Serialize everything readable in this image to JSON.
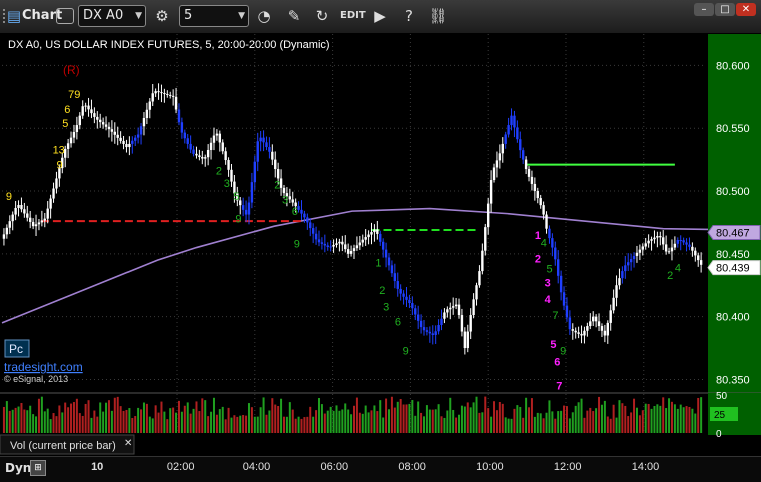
{
  "window": {
    "app_title": "Chart",
    "symbol": "DX A0",
    "interval": "5",
    "minimize_icon": "minimize-icon",
    "maximize_icon": "maximize-icon",
    "close_icon": "close-icon"
  },
  "chart_header": {
    "title": "DX A0, US DOLLAR INDEX FUTURES, 5, 20:00-20:00 (Dynamic)",
    "badge_r": "(R)"
  },
  "branding": {
    "pc_label": "Pc",
    "site": "tradesight.com",
    "copyright": "© eSignal, 2013"
  },
  "colors": {
    "background": "#000000",
    "price_axis_bg": "#006000",
    "grid": "#3a3a3a",
    "bar": "#ffffff",
    "bar_down_run": "#1f3fff",
    "moving_average": "#a080d0",
    "resistance_line": "#e02020",
    "support_line": "#20e020",
    "top_line": "#40ff40",
    "count_yellow": "#ffe020",
    "count_green": "#20b020",
    "count_magenta": "#ff20ff"
  },
  "chart_data": {
    "type": "candlestick",
    "ylim": [
      80.34,
      80.625
    ],
    "ytick_labels": [
      "80.600",
      "80.550",
      "80.500",
      "80.450",
      "80.400",
      "80.350"
    ],
    "xtick_labels": [
      "10",
      "02:00",
      "04:00",
      "06:00",
      "08:00",
      "10:00",
      "12:00",
      "14:00"
    ],
    "price_markers": [
      {
        "label": "80.467",
        "value": 80.467,
        "style": "purple"
      },
      {
        "label": "80.439",
        "value": 80.439,
        "style": "white"
      }
    ],
    "moving_average_points": [
      [
        0,
        80.395
      ],
      [
        2,
        80.42
      ],
      [
        4,
        80.445
      ],
      [
        5,
        80.455
      ],
      [
        7,
        80.472
      ],
      [
        9,
        80.484
      ],
      [
        11,
        80.486
      ],
      [
        13,
        80.482
      ],
      [
        15,
        80.476
      ],
      [
        17,
        80.47
      ],
      [
        19,
        80.469
      ],
      [
        21,
        80.472
      ],
      [
        23,
        80.472
      ],
      [
        25,
        80.47
      ],
      [
        27,
        80.468
      ],
      [
        28,
        80.467
      ]
    ],
    "horizontal_lines": [
      {
        "name": "red-dashed",
        "value": 80.476,
        "x_start": 1.0,
        "x_end": 7.75,
        "style": "dashed",
        "color": "red"
      },
      {
        "name": "green-dashed",
        "value": 80.469,
        "x_start": 9.5,
        "x_end": 12.2,
        "style": "dashed",
        "color": "green"
      },
      {
        "name": "green-solid",
        "value": 80.521,
        "x_start": 13.5,
        "x_end": 17.3,
        "style": "solid",
        "color": "brightgreen"
      }
    ],
    "price_path": [
      [
        0.0,
        80.462
      ],
      [
        0.4,
        80.49
      ],
      [
        0.8,
        80.472
      ],
      [
        1.1,
        80.478
      ],
      [
        1.4,
        80.51
      ],
      [
        1.6,
        80.532
      ],
      [
        1.9,
        80.55
      ],
      [
        2.1,
        80.57
      ],
      [
        2.4,
        80.558
      ],
      [
        2.8,
        80.548
      ],
      [
        3.2,
        80.535
      ],
      [
        3.5,
        80.545
      ],
      [
        3.9,
        80.58
      ],
      [
        4.1,
        80.578
      ],
      [
        4.4,
        80.575
      ],
      [
        4.6,
        80.548
      ],
      [
        4.9,
        80.53
      ],
      [
        5.2,
        80.525
      ],
      [
        5.5,
        80.548
      ],
      [
        5.8,
        80.52
      ],
      [
        6.0,
        80.495
      ],
      [
        6.3,
        80.48
      ],
      [
        6.6,
        80.545
      ],
      [
        6.9,
        80.53
      ],
      [
        7.2,
        80.5
      ],
      [
        7.5,
        80.49
      ],
      [
        7.8,
        80.478
      ],
      [
        8.1,
        80.46
      ],
      [
        8.4,
        80.455
      ],
      [
        8.7,
        80.46
      ],
      [
        8.9,
        80.45
      ],
      [
        9.3,
        80.462
      ],
      [
        9.6,
        80.47
      ],
      [
        9.9,
        80.445
      ],
      [
        10.2,
        80.42
      ],
      [
        10.5,
        80.41
      ],
      [
        10.8,
        80.39
      ],
      [
        11.1,
        80.385
      ],
      [
        11.4,
        80.405
      ],
      [
        11.7,
        80.41
      ],
      [
        11.9,
        80.375
      ],
      [
        12.1,
        80.41
      ],
      [
        12.3,
        80.44
      ],
      [
        12.6,
        80.515
      ],
      [
        12.8,
        80.53
      ],
      [
        13.1,
        80.56
      ],
      [
        13.3,
        80.535
      ],
      [
        13.5,
        80.515
      ],
      [
        13.7,
        80.5
      ],
      [
        13.9,
        80.485
      ],
      [
        14.0,
        80.47
      ],
      [
        14.2,
        80.45
      ],
      [
        14.4,
        80.415
      ],
      [
        14.6,
        80.39
      ],
      [
        14.9,
        80.385
      ],
      [
        15.2,
        80.4
      ],
      [
        15.5,
        80.385
      ],
      [
        15.8,
        80.425
      ],
      [
        16.0,
        80.44
      ],
      [
        16.3,
        80.45
      ],
      [
        16.6,
        80.46
      ],
      [
        16.9,
        80.465
      ],
      [
        17.1,
        80.45
      ],
      [
        17.4,
        80.462
      ],
      [
        17.7,
        80.455
      ],
      [
        18.0,
        80.44
      ]
    ],
    "down_runs": [
      [
        3.3,
        3.6
      ],
      [
        4.5,
        5.0
      ],
      [
        6.2,
        6.9
      ],
      [
        7.6,
        8.5
      ],
      [
        9.7,
        11.3
      ],
      [
        12.9,
        13.4
      ],
      [
        14.0,
        14.6
      ],
      [
        15.9,
        16.3
      ],
      [
        17.3,
        17.7
      ]
    ],
    "count_labels": [
      {
        "text": "9",
        "x": 0.1,
        "y": 80.493,
        "color": "yellow"
      },
      {
        "text": "79",
        "x": 1.7,
        "y": 80.574,
        "color": "yellow"
      },
      {
        "text": "6",
        "x": 1.6,
        "y": 80.562,
        "color": "yellow"
      },
      {
        "text": "5",
        "x": 1.55,
        "y": 80.551,
        "color": "yellow"
      },
      {
        "text": "13",
        "x": 1.3,
        "y": 80.53,
        "color": "yellow"
      },
      {
        "text": "9",
        "x": 1.4,
        "y": 80.518,
        "color": "yellow"
      },
      {
        "text": "2",
        "x": 5.5,
        "y": 80.513,
        "color": "green"
      },
      {
        "text": "3",
        "x": 5.7,
        "y": 80.503,
        "color": "green"
      },
      {
        "text": "5",
        "x": 5.95,
        "y": 80.493,
        "color": "green"
      },
      {
        "text": "9",
        "x": 6.0,
        "y": 80.475,
        "color": "green"
      },
      {
        "text": "2",
        "x": 7.0,
        "y": 80.502,
        "color": "green"
      },
      {
        "text": "3",
        "x": 7.2,
        "y": 80.49,
        "color": "green"
      },
      {
        "text": "6",
        "x": 7.45,
        "y": 80.481,
        "color": "green"
      },
      {
        "text": "9",
        "x": 7.5,
        "y": 80.455,
        "color": "green"
      },
      {
        "text": "1",
        "x": 9.6,
        "y": 80.44,
        "color": "green"
      },
      {
        "text": "2",
        "x": 9.7,
        "y": 80.418,
        "color": "green"
      },
      {
        "text": "3",
        "x": 9.8,
        "y": 80.405,
        "color": "green"
      },
      {
        "text": "6",
        "x": 10.1,
        "y": 80.393,
        "color": "green"
      },
      {
        "text": "9",
        "x": 10.3,
        "y": 80.37,
        "color": "green"
      },
      {
        "text": "1",
        "x": 13.7,
        "y": 80.462,
        "color": "magenta"
      },
      {
        "text": "2",
        "x": 13.7,
        "y": 80.443,
        "color": "magenta"
      },
      {
        "text": "3",
        "x": 13.95,
        "y": 80.424,
        "color": "magenta"
      },
      {
        "text": "4",
        "x": 13.95,
        "y": 80.411,
        "color": "magenta"
      },
      {
        "text": "5",
        "x": 14.1,
        "y": 80.375,
        "color": "magenta"
      },
      {
        "text": "6",
        "x": 14.2,
        "y": 80.361,
        "color": "magenta"
      },
      {
        "text": "7",
        "x": 14.25,
        "y": 80.342,
        "color": "magenta"
      },
      {
        "text": "4",
        "x": 13.85,
        "y": 80.456,
        "color": "green"
      },
      {
        "text": "5",
        "x": 14.0,
        "y": 80.435,
        "color": "green"
      },
      {
        "text": "7",
        "x": 14.15,
        "y": 80.398,
        "color": "green"
      },
      {
        "text": "9",
        "x": 14.35,
        "y": 80.37,
        "color": "green"
      },
      {
        "text": "2",
        "x": 17.1,
        "y": 80.43,
        "color": "green"
      },
      {
        "text": "4",
        "x": 17.3,
        "y": 80.436,
        "color": "green"
      }
    ],
    "volume": {
      "ylim": [
        0,
        50
      ],
      "ytick_labels": [
        "50",
        "25",
        "0"
      ],
      "current_label": "25"
    }
  },
  "volume_panel": {
    "legend": "Vol (current price bar)",
    "close_icon": "close-icon"
  },
  "status_bar": {
    "mode": "Dyn"
  }
}
